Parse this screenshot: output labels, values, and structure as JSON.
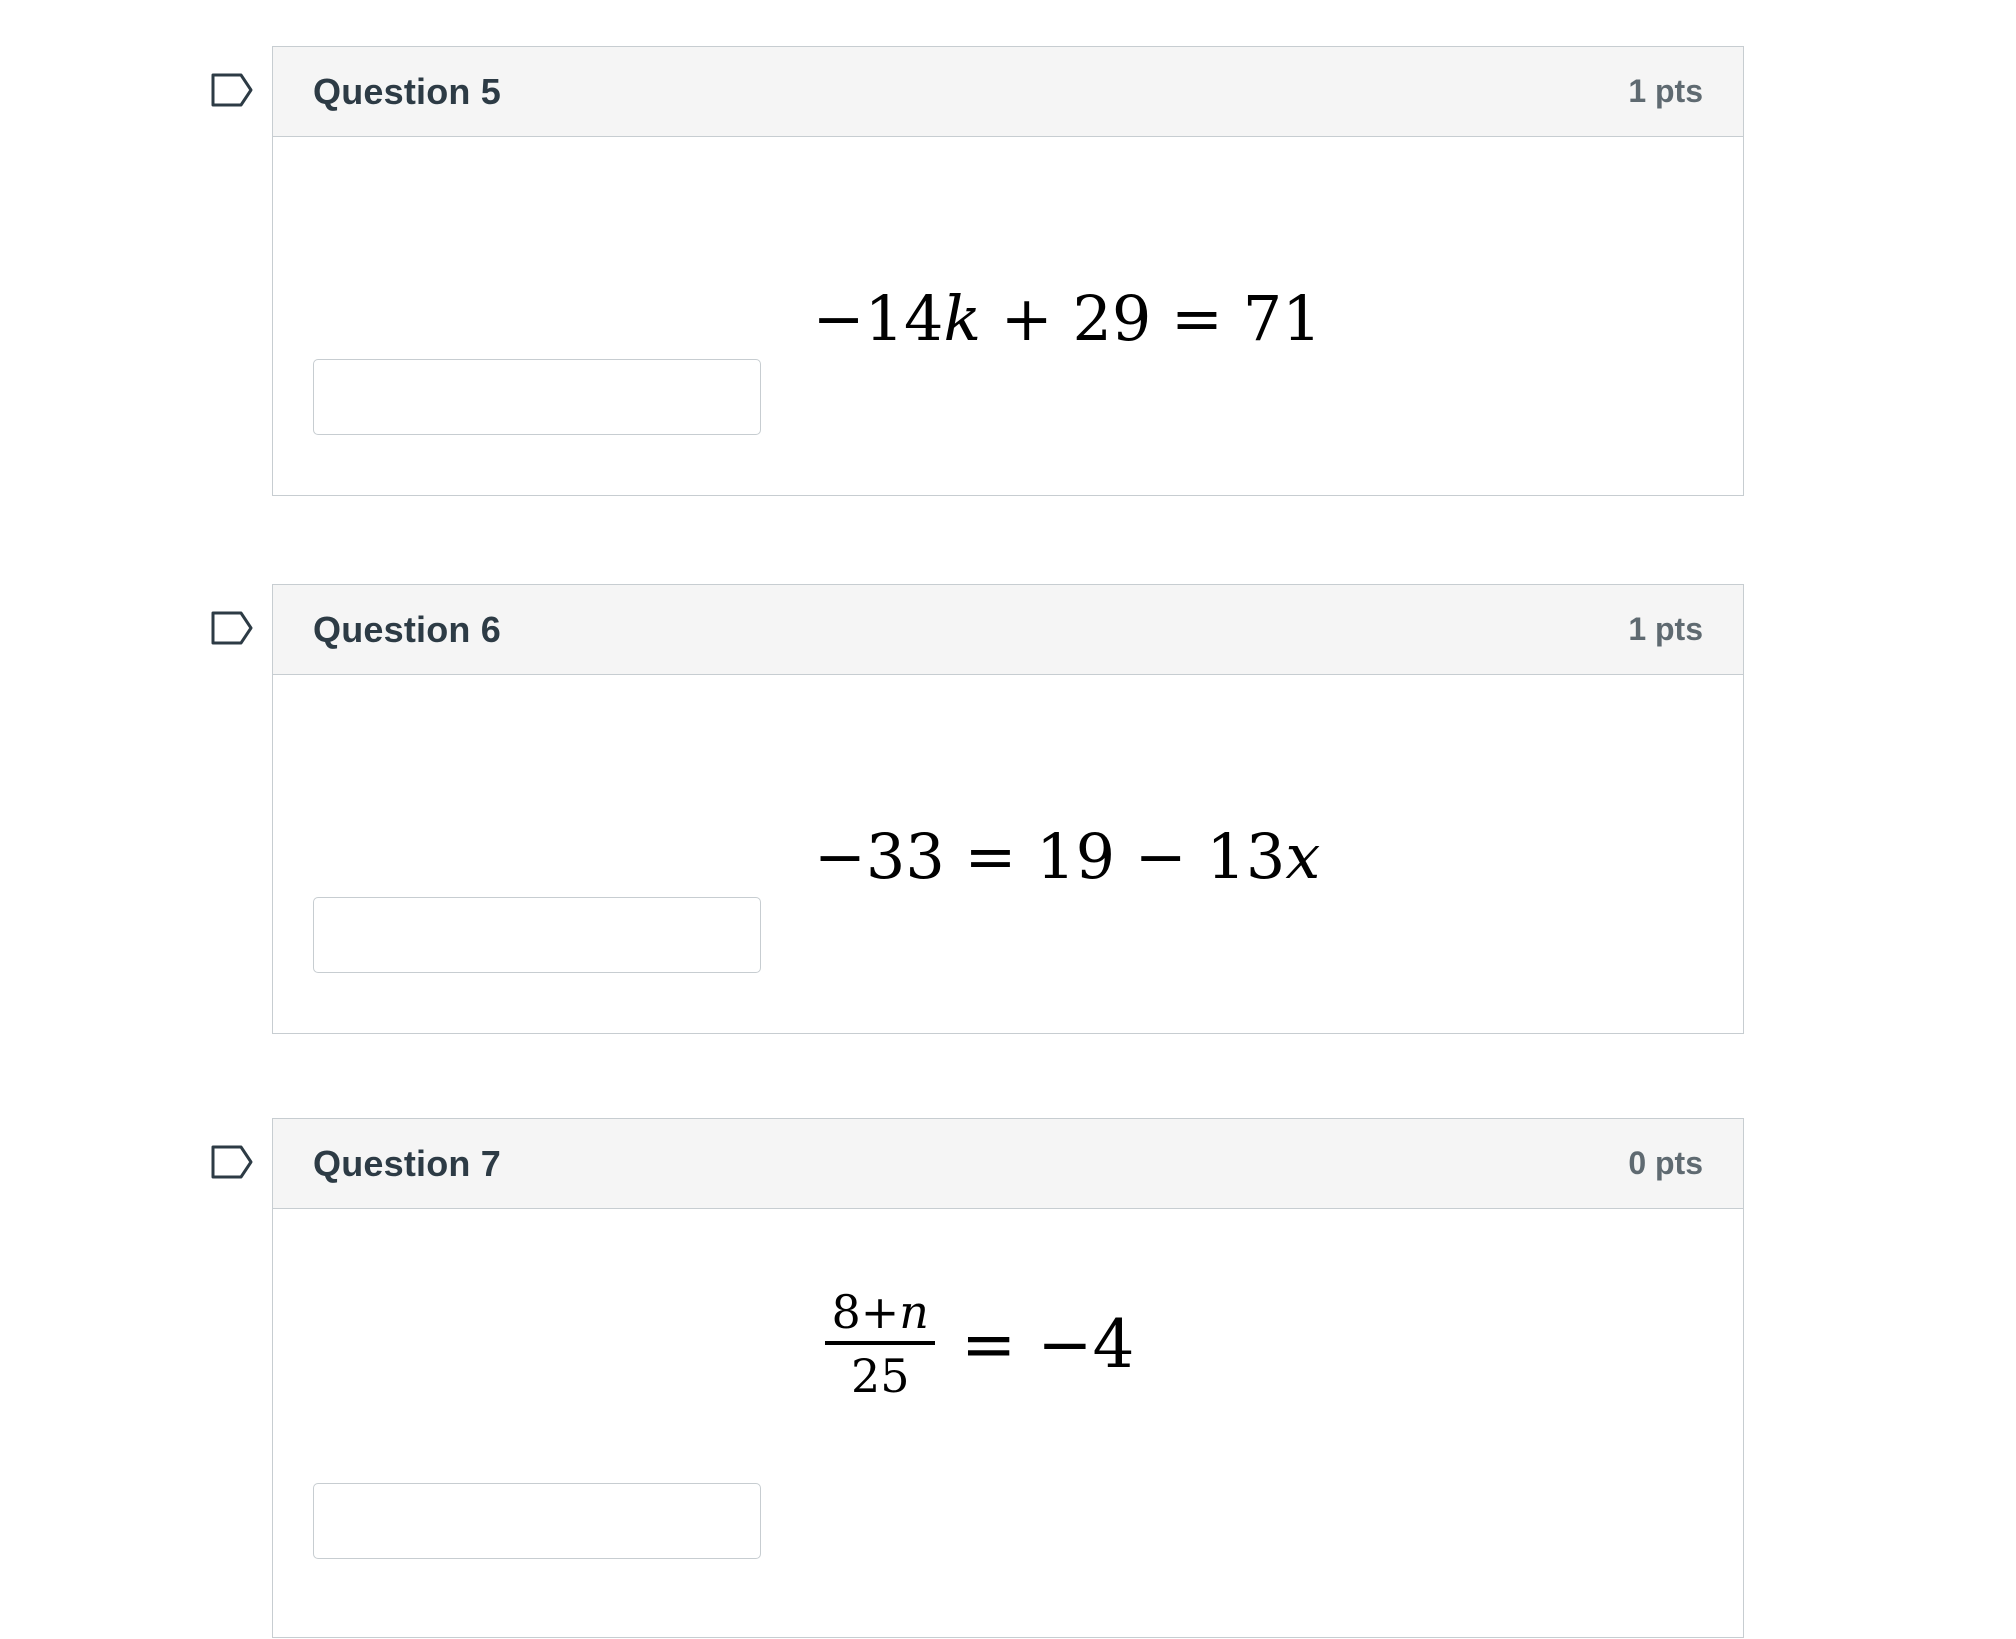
{
  "questions": [
    {
      "title": "Question 5",
      "points": "1 pts",
      "equation": "−14k + 29 = 71",
      "answer_value": ""
    },
    {
      "title": "Question 6",
      "points": "1 pts",
      "equation": "−33 = 19 − 13x",
      "answer_value": ""
    },
    {
      "title": "Question 7",
      "points": "0 pts",
      "equation_numerator": "8+n",
      "equation_denominator": "25",
      "equation_rhs": "= −4",
      "answer_value": ""
    }
  ],
  "icons": {
    "flag": "bookmark-flag-icon"
  },
  "colors": {
    "header_bg": "#f5f5f5",
    "border": "#c7cdd1",
    "title_text": "#2d3b45",
    "points_text": "#5f6a71"
  }
}
